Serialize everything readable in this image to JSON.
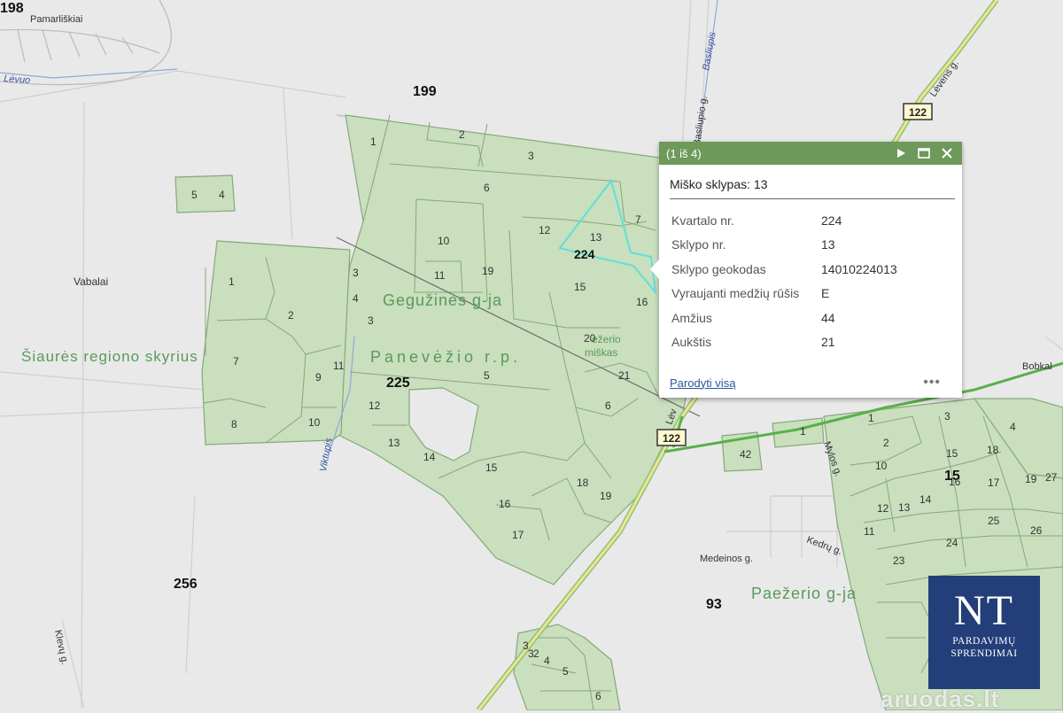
{
  "map": {
    "place_labels": {
      "pamarliskiai": "Pamarliškiai",
      "vabalai": "Vabalai",
      "bobkal": "Bobkal"
    },
    "block_numbers": {
      "b198": "198",
      "b199": "199",
      "b224": "224",
      "b225": "225",
      "b256": "256",
      "b93": "93",
      "b15": "15"
    },
    "area_labels": {
      "geguzines": "Gegužinės g-ja",
      "panevezio": "Panevėžio r.p.",
      "siaures": "Šiaurės regiono skyrius",
      "paezerio": "Paežerio g-ja",
      "ezerio_miskas_1": "ežerio",
      "ezerio_miskas_2": "miškas"
    },
    "street_labels": {
      "basliupis": "Basliupis",
      "basliupio": "Basliupio g.",
      "levens": "Lėvens g.",
      "levuo": "Lėvuo",
      "viktupis": "Viktupis",
      "medeinos": "Medeinos g.",
      "kedru": "Kedrų g.",
      "mylos": "Mylos g.",
      "klevu": "Klevų g.",
      "levens_lower": "Lėv"
    },
    "road_shields": [
      "122",
      "122"
    ],
    "parcel_numbers": {
      "n224": [
        "1",
        "2",
        "3",
        "6",
        "7",
        "10",
        "11",
        "12",
        "13",
        "15",
        "16",
        "19",
        "20",
        "21",
        "3",
        "4"
      ],
      "n225": [
        "1",
        "2",
        "3",
        "4",
        "5",
        "6",
        "7",
        "8",
        "9",
        "10",
        "11",
        "12",
        "13",
        "14",
        "15",
        "16",
        "17",
        "18",
        "19"
      ],
      "n199": [
        "5",
        "4"
      ],
      "n15": [
        "1",
        "2",
        "3",
        "4",
        "10",
        "12",
        "13",
        "14",
        "15",
        "16",
        "17",
        "18",
        "19",
        "23",
        "24",
        "25",
        "26",
        "27",
        "42",
        "11",
        "1"
      ],
      "n_bottom": [
        "3",
        "4",
        "5",
        "6",
        "3",
        "2"
      ]
    }
  },
  "popup": {
    "counter": "(1 iš 4)",
    "title": "Miško sklypas: 13",
    "rows": [
      {
        "key": "Kvartalo nr.",
        "value": "224"
      },
      {
        "key": "Sklypo nr.",
        "value": "13"
      },
      {
        "key": "Sklypo geokodas",
        "value": "14010224013"
      },
      {
        "key": "Vyraujanti medžių rūšis",
        "value": "E"
      },
      {
        "key": "Amžius",
        "value": "44"
      },
      {
        "key": "Aukštis",
        "value": "21"
      }
    ],
    "show_all": "Parodyti visą",
    "more": "•••",
    "header_color": "#6d9a5a"
  },
  "logo": {
    "letters": "NT",
    "line1": "PARDAVIMŲ",
    "line2": "SPRENDIMAI",
    "color": "#233e78"
  },
  "watermark": "aruodas.lt",
  "colors": {
    "forest": "#c9dfbe",
    "forest_border": "#86a87a",
    "road": "#58b04a",
    "selection": "#5fe0d8"
  }
}
